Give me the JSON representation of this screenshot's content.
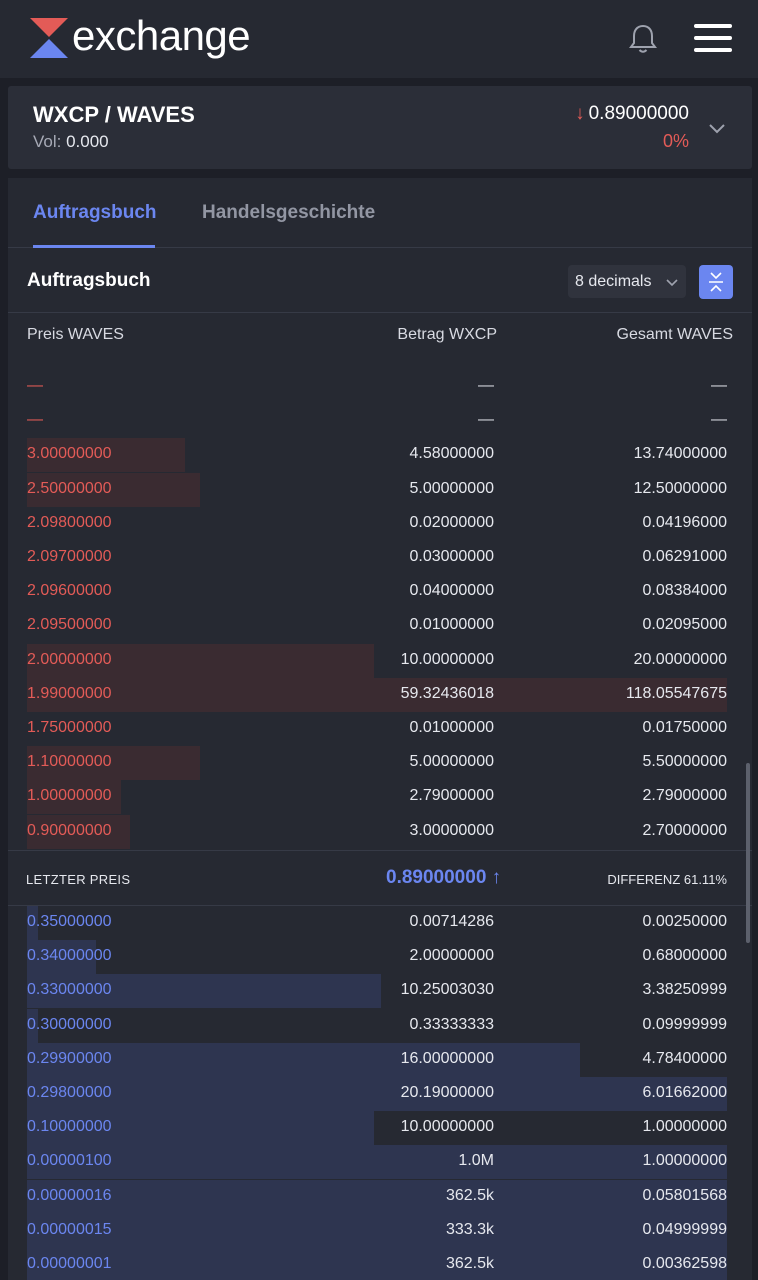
{
  "app": {
    "logo_text": "exchange"
  },
  "pair": {
    "name": "WXCP / WAVES",
    "vol_label": "Vol:",
    "vol_value": "0.000",
    "price": "0.89000000",
    "change": "0%"
  },
  "tabs": [
    {
      "label": "Auftragsbuch"
    },
    {
      "label": "Handelsgeschichte"
    }
  ],
  "orderbook": {
    "title": "Auftragsbuch",
    "decimals": "8 decimals",
    "columns": {
      "price": "Preis WAVES",
      "amount": "Betrag WXCP",
      "total": "Gesamt WAVES"
    },
    "asks": [
      {
        "price": "—",
        "amount": "—",
        "total": "—",
        "depth": 0
      },
      {
        "price": "—",
        "amount": "—",
        "total": "—",
        "depth": 0
      },
      {
        "price": "3.00000000",
        "amount": "4.58000000",
        "total": "13.74000000",
        "depth": 0.226
      },
      {
        "price": "2.50000000",
        "amount": "5.00000000",
        "total": "12.50000000",
        "depth": 0.247
      },
      {
        "price": "2.09800000",
        "amount": "0.02000000",
        "total": "0.04196000",
        "depth": 0
      },
      {
        "price": "2.09700000",
        "amount": "0.03000000",
        "total": "0.06291000",
        "depth": 0
      },
      {
        "price": "2.09600000",
        "amount": "0.04000000",
        "total": "0.08384000",
        "depth": 0
      },
      {
        "price": "2.09500000",
        "amount": "0.01000000",
        "total": "0.02095000",
        "depth": 0
      },
      {
        "price": "2.00000000",
        "amount": "10.00000000",
        "total": "20.00000000",
        "depth": 0.496
      },
      {
        "price": "1.99000000",
        "amount": "59.32436018",
        "total": "118.05547675",
        "depth": 1.0
      },
      {
        "price": "1.75000000",
        "amount": "0.01000000",
        "total": "0.01750000",
        "depth": 0
      },
      {
        "price": "1.10000000",
        "amount": "5.00000000",
        "total": "5.50000000",
        "depth": 0.247
      },
      {
        "price": "1.00000000",
        "amount": "2.79000000",
        "total": "2.79000000",
        "depth": 0.134
      },
      {
        "price": "0.90000000",
        "amount": "3.00000000",
        "total": "2.70000000",
        "depth": 0.147
      }
    ],
    "last_price": {
      "label": "LETZTER PREIS",
      "value": "0.89000000 ↑",
      "diff": "DIFFERENZ 61.11%"
    },
    "bids": [
      {
        "price": "0.35000000",
        "amount": "0.00714286",
        "total": "0.00250000",
        "depth": 0.016
      },
      {
        "price": "0.34000000",
        "amount": "2.00000000",
        "total": "0.68000000",
        "depth": 0.099
      },
      {
        "price": "0.33000000",
        "amount": "10.25003030",
        "total": "3.38250999",
        "depth": 0.506
      },
      {
        "price": "0.30000000",
        "amount": "0.33333333",
        "total": "0.09999999",
        "depth": 0.016
      },
      {
        "price": "0.29900000",
        "amount": "16.00000000",
        "total": "4.78400000",
        "depth": 0.79
      },
      {
        "price": "0.29800000",
        "amount": "20.19000000",
        "total": "6.01662000",
        "depth": 1.0
      },
      {
        "price": "0.10000000",
        "amount": "10.00000000",
        "total": "1.00000000",
        "depth": 0.496
      },
      {
        "price": "0.00000100",
        "amount": "1.0M",
        "total": "1.00000000",
        "depth": 1.0
      },
      {
        "price": "0.00000016",
        "amount": "362.5k",
        "total": "0.05801568",
        "depth": 1.0
      },
      {
        "price": "0.00000015",
        "amount": "333.3k",
        "total": "0.04999999",
        "depth": 1.0
      },
      {
        "price": "0.00000001",
        "amount": "362.5k",
        "total": "0.00362598",
        "depth": 1.0
      }
    ]
  },
  "colors": {
    "ask": "#e35b57",
    "bid": "#6b86f0",
    "ask_bar": "#3a2b31",
    "bid_bar": "#2e3550"
  }
}
